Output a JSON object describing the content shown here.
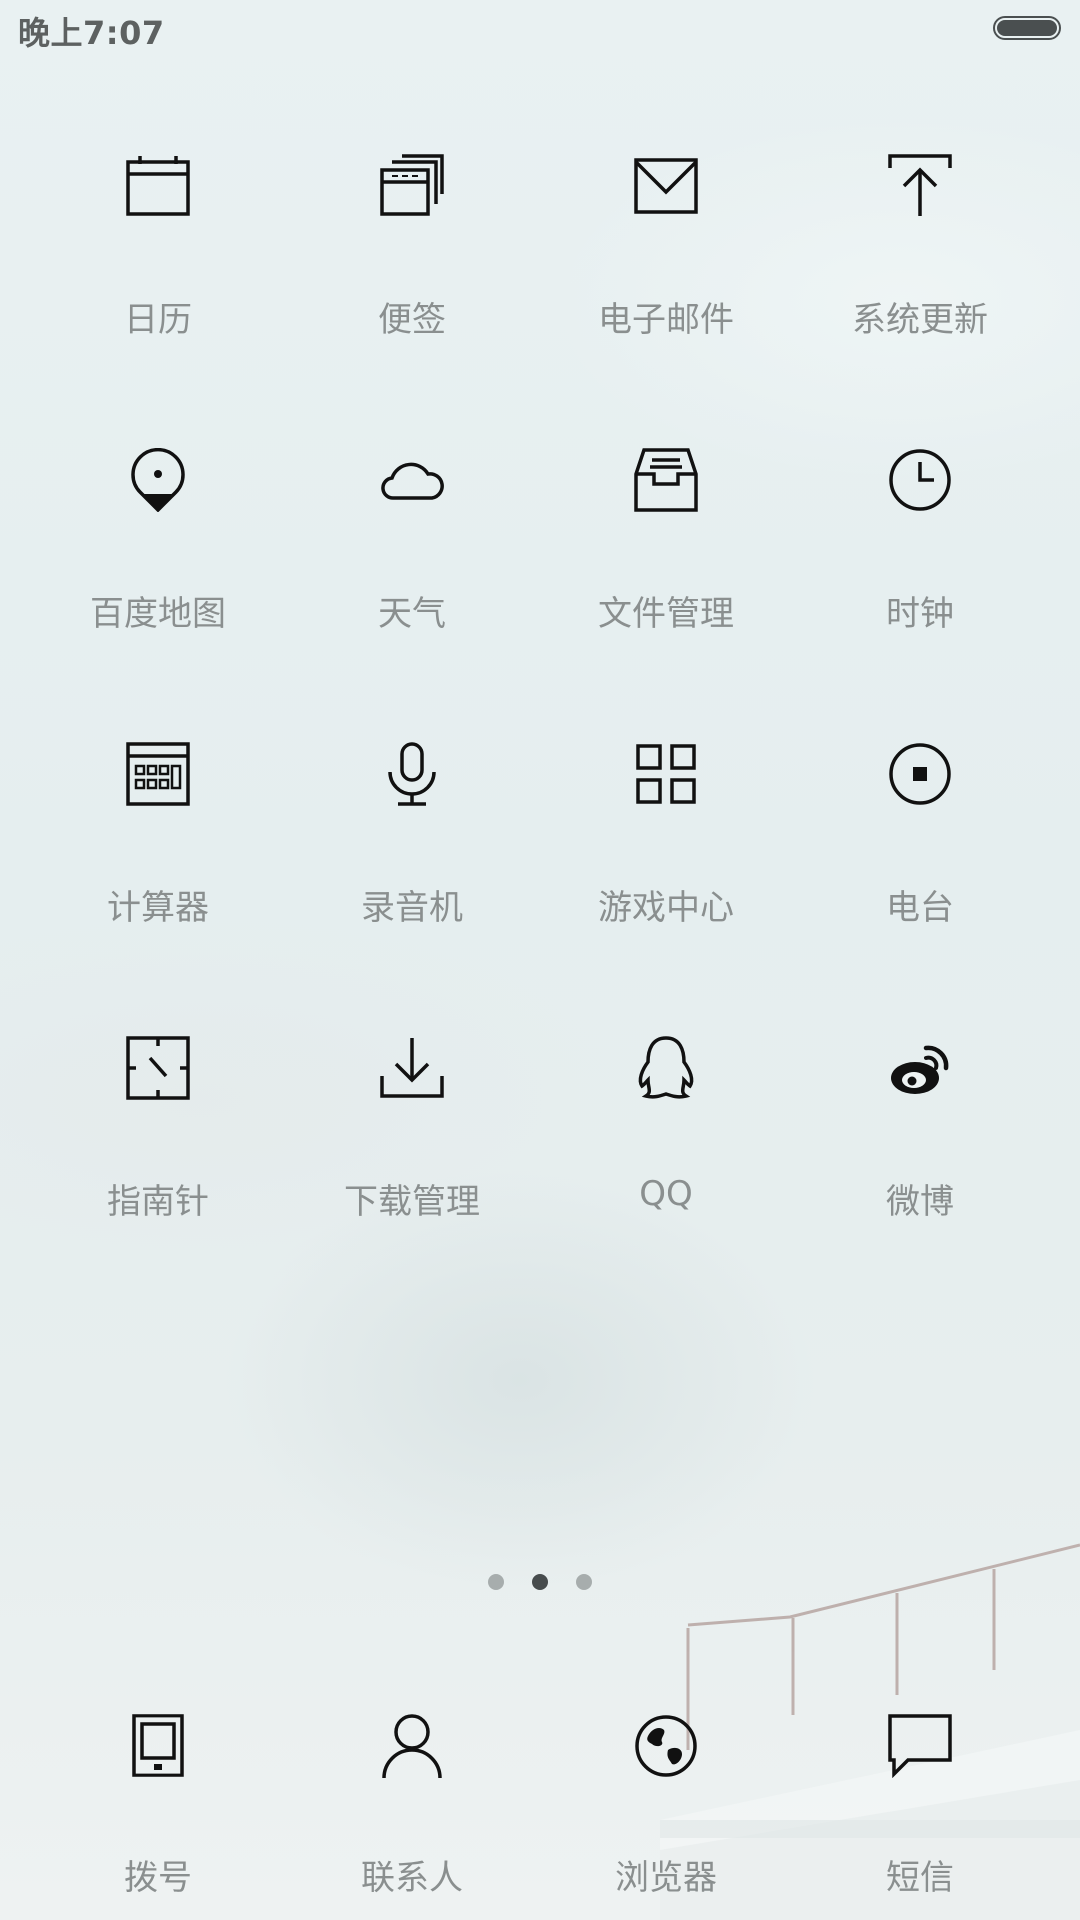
{
  "status_bar": {
    "time": "晚上7:07",
    "battery_level": 1.0
  },
  "apps": [
    {
      "label": "日历",
      "icon": "calendar-icon"
    },
    {
      "label": "便签",
      "icon": "notes-icon"
    },
    {
      "label": "电子邮件",
      "icon": "mail-icon"
    },
    {
      "label": "系统更新",
      "icon": "system-update-icon"
    },
    {
      "label": "百度地图",
      "icon": "map-pin-icon"
    },
    {
      "label": "天气",
      "icon": "cloud-icon"
    },
    {
      "label": "文件管理",
      "icon": "file-tray-icon"
    },
    {
      "label": "时钟",
      "icon": "clock-icon"
    },
    {
      "label": "计算器",
      "icon": "calculator-icon"
    },
    {
      "label": "录音机",
      "icon": "microphone-icon"
    },
    {
      "label": "游戏中心",
      "icon": "game-grid-icon"
    },
    {
      "label": "电台",
      "icon": "radio-icon"
    },
    {
      "label": "指南针",
      "icon": "compass-icon"
    },
    {
      "label": "下载管理",
      "icon": "download-icon"
    },
    {
      "label": "QQ",
      "icon": "qq-penguin-icon"
    },
    {
      "label": "微博",
      "icon": "weibo-icon"
    }
  ],
  "page_indicator": {
    "count": 3,
    "active_index": 1
  },
  "dock": [
    {
      "label": "拨号",
      "icon": "phone-icon"
    },
    {
      "label": "联系人",
      "icon": "contact-person-icon"
    },
    {
      "label": "浏览器",
      "icon": "globe-icon"
    },
    {
      "label": "短信",
      "icon": "message-bubble-icon"
    }
  ],
  "colors": {
    "label": "#8a8f8f",
    "icon_stroke": "#111111",
    "dot_active": "#474c4d",
    "dot_inactive": "#a7adad"
  }
}
